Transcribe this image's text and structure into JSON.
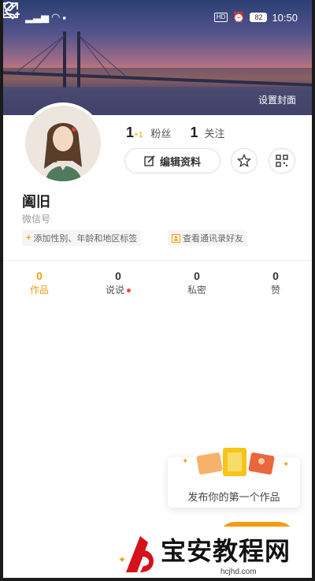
{
  "status_bar": {
    "time": "10:50",
    "battery": "82",
    "hd": "HD"
  },
  "header": {
    "set_cover_label": "设置封面"
  },
  "profile": {
    "followers_count": "1",
    "followers_delta": "+1",
    "followers_label": "粉丝",
    "following_count": "1",
    "following_label": "关注",
    "edit_label": "编辑资料",
    "name": "阖旧",
    "wechat_label": "微信号",
    "tags": [
      {
        "icon": "plus-icon",
        "text": "添加性别、年龄和地区标签"
      },
      {
        "icon": "contacts-icon",
        "text": "查看通讯录好友"
      }
    ]
  },
  "tabs": [
    {
      "count": "0",
      "label": "作品",
      "active": true
    },
    {
      "count": "0",
      "label": "说说",
      "has_dot": true
    },
    {
      "count": "0",
      "label": "私密"
    },
    {
      "count": "0",
      "label": "赞"
    }
  ],
  "publish": {
    "prompt": "发布你的第一个作品"
  },
  "watermark": {
    "title": "宝安教程网",
    "sub": "hcjhd.com"
  },
  "colors": {
    "accent": "#f39c12",
    "dot": "#e74c3c"
  }
}
